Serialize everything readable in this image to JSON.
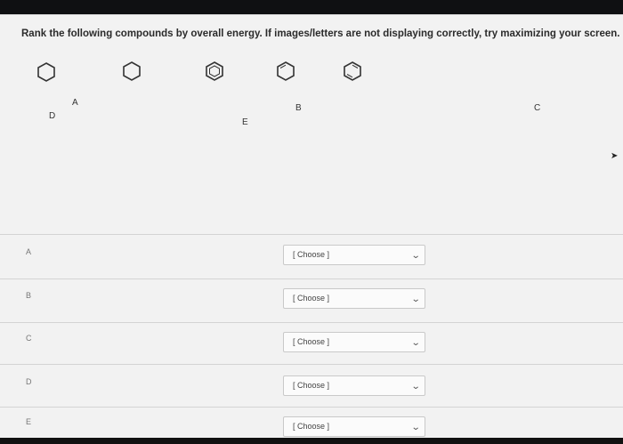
{
  "question": {
    "text": "Rank the following compounds by overall energy. If images/letters are not displaying correctly, try maximizing your screen."
  },
  "molecules": {
    "icon": "hexagon-ring-icon",
    "letters": [
      "A",
      "B",
      "C",
      "D",
      "E"
    ]
  },
  "ranking": {
    "rows": [
      {
        "label": "A",
        "placeholder": "[ Choose ]"
      },
      {
        "label": "B",
        "placeholder": "[ Choose ]"
      },
      {
        "label": "C",
        "placeholder": "[ Choose ]"
      },
      {
        "label": "D",
        "placeholder": "[ Choose ]"
      },
      {
        "label": "E",
        "placeholder": "[ Choose ]"
      }
    ],
    "dropdown_icon": "chevron-down-icon"
  },
  "colors": {
    "background": "#f2f2f2",
    "divider": "#d4d4d4",
    "select_border": "#c9c9c9"
  }
}
